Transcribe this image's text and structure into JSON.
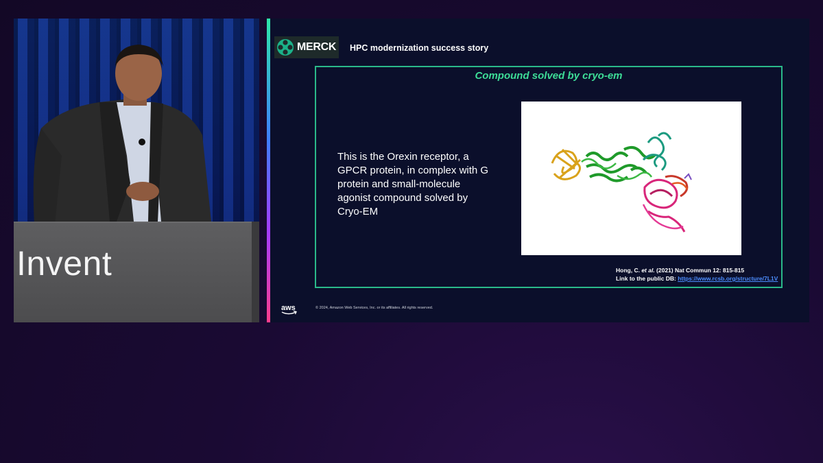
{
  "podium": {
    "text": "Invent"
  },
  "slide": {
    "logo": {
      "text": "MERCK",
      "color": "#1bb28a"
    },
    "header": "HPC modernization success story",
    "frame_title": "Compound solved by cryo-em",
    "body_text": "This is the Orexin receptor, a GPCR protein, in complex with G protein and small-molecule agonist compound solved by Cryo-EM",
    "citation": {
      "line1_prefix": "Hong, C. ",
      "line1_italic": "et al.",
      "line1_suffix": " (2021) Nat Commun 12: 815-815",
      "line2_prefix": "Link to the public DB: ",
      "link": "https://www.rcsb.org/structure/7L1V"
    },
    "aws_logo": {
      "text": "aws"
    },
    "copyright": "© 2024, Amazon Web Services, Inc. or its affiliates. All rights reserved.",
    "colors": {
      "accent": "#3ddc97",
      "frame": "#2ab98a",
      "link": "#4c8dff"
    }
  }
}
